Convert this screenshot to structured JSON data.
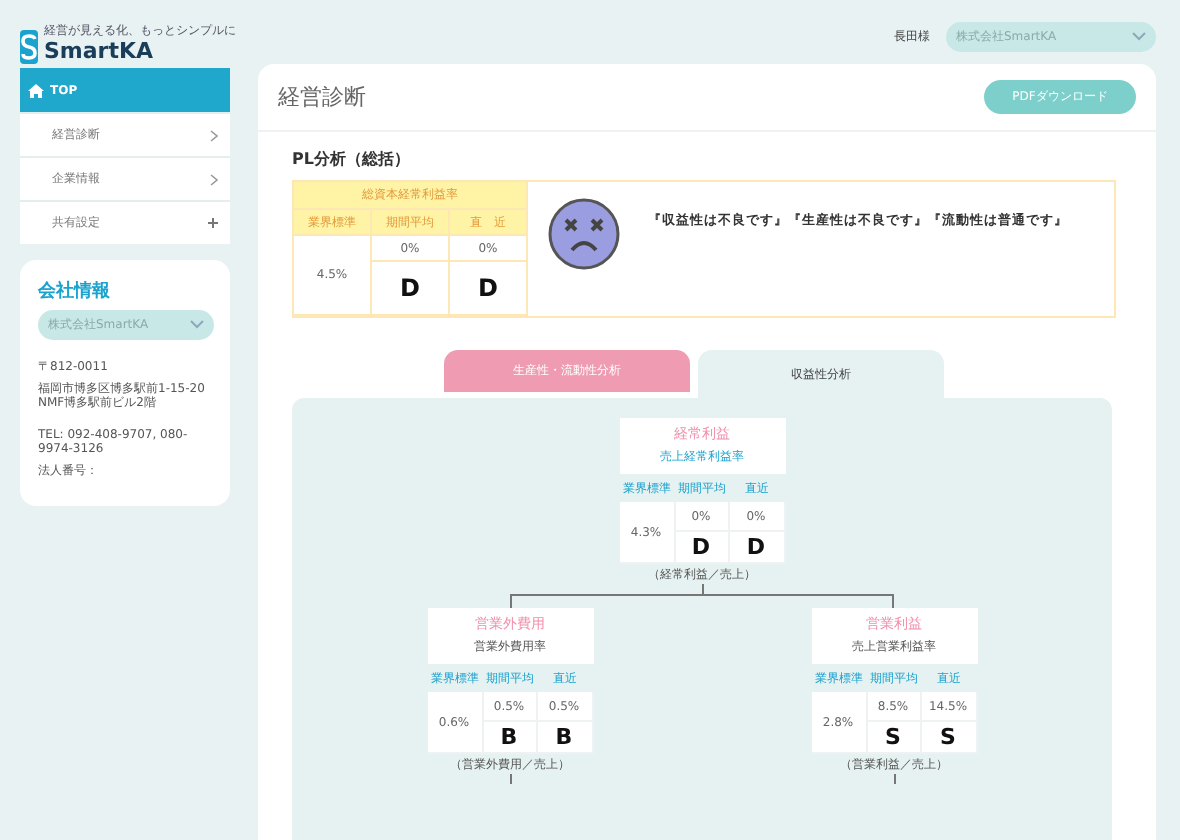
{
  "logo": {
    "tagline": "経営が見える化、もっとシンプルに",
    "name": "SmartKA"
  },
  "user": {
    "name": "長田様",
    "company_select": "株式会社SmartKA"
  },
  "sidebar": {
    "items": [
      {
        "label": "TOP",
        "selected": true,
        "kind": "home"
      },
      {
        "label": "経営診断",
        "selected": false,
        "kind": "arrow"
      },
      {
        "label": "企業情報",
        "selected": false,
        "kind": "arrow"
      },
      {
        "label": "共有設定",
        "selected": false,
        "kind": "plus"
      }
    ]
  },
  "company_info": {
    "title": "会社情報",
    "select": "株式会社SmartKA",
    "address": [
      "〒812-0011",
      "福岡市博多区博多駅前1-15-20 NMF博多駅前ビル2階"
    ],
    "contact": [
      "TEL: 092-408-9707, 080-9974-3126",
      "法人番号："
    ]
  },
  "page": {
    "title": "経営診断",
    "pdf_button": "PDFダウンロード"
  },
  "pl_summary": {
    "title": "PL分析（総括）",
    "metric": "総資本経常利益率",
    "headers": [
      "業界標準",
      "期間平均",
      "直　近"
    ],
    "industry": "4.5%",
    "average": "0%",
    "recent": "0%",
    "average_grade": "D",
    "recent_grade": "D",
    "comment": "『収益性は不良です』『生産性は不良です』『流動性は普通です』"
  },
  "tabs": [
    {
      "label": "生産性・流動性分析",
      "selected": false
    },
    {
      "label": "収益性分析",
      "selected": true
    }
  ],
  "tree": {
    "title": "経常利益",
    "subtitle": "売上経常利益率",
    "headers": [
      "業界標準",
      "期間平均",
      "直近"
    ],
    "industry": "4.3%",
    "average": "0%",
    "recent": "0%",
    "average_grade": "D",
    "recent_grade": "D",
    "formula": "（経常利益／売上）",
    "children": [
      {
        "title": "営業外費用",
        "subtitle": "営業外費用率",
        "headers": [
          "業界標準",
          "期間平均",
          "直近"
        ],
        "industry": "0.6%",
        "average": "0.5%",
        "recent": "0.5%",
        "average_grade": "B",
        "recent_grade": "B",
        "formula": "（営業外費用／売上）"
      },
      {
        "title": "営業利益",
        "subtitle": "売上営業利益率",
        "headers": [
          "業界標準",
          "期間平均",
          "直近"
        ],
        "industry": "2.8%",
        "average": "8.5%",
        "recent": "14.5%",
        "average_grade": "S",
        "recent_grade": "S",
        "formula": "（営業利益／売上）"
      }
    ]
  }
}
